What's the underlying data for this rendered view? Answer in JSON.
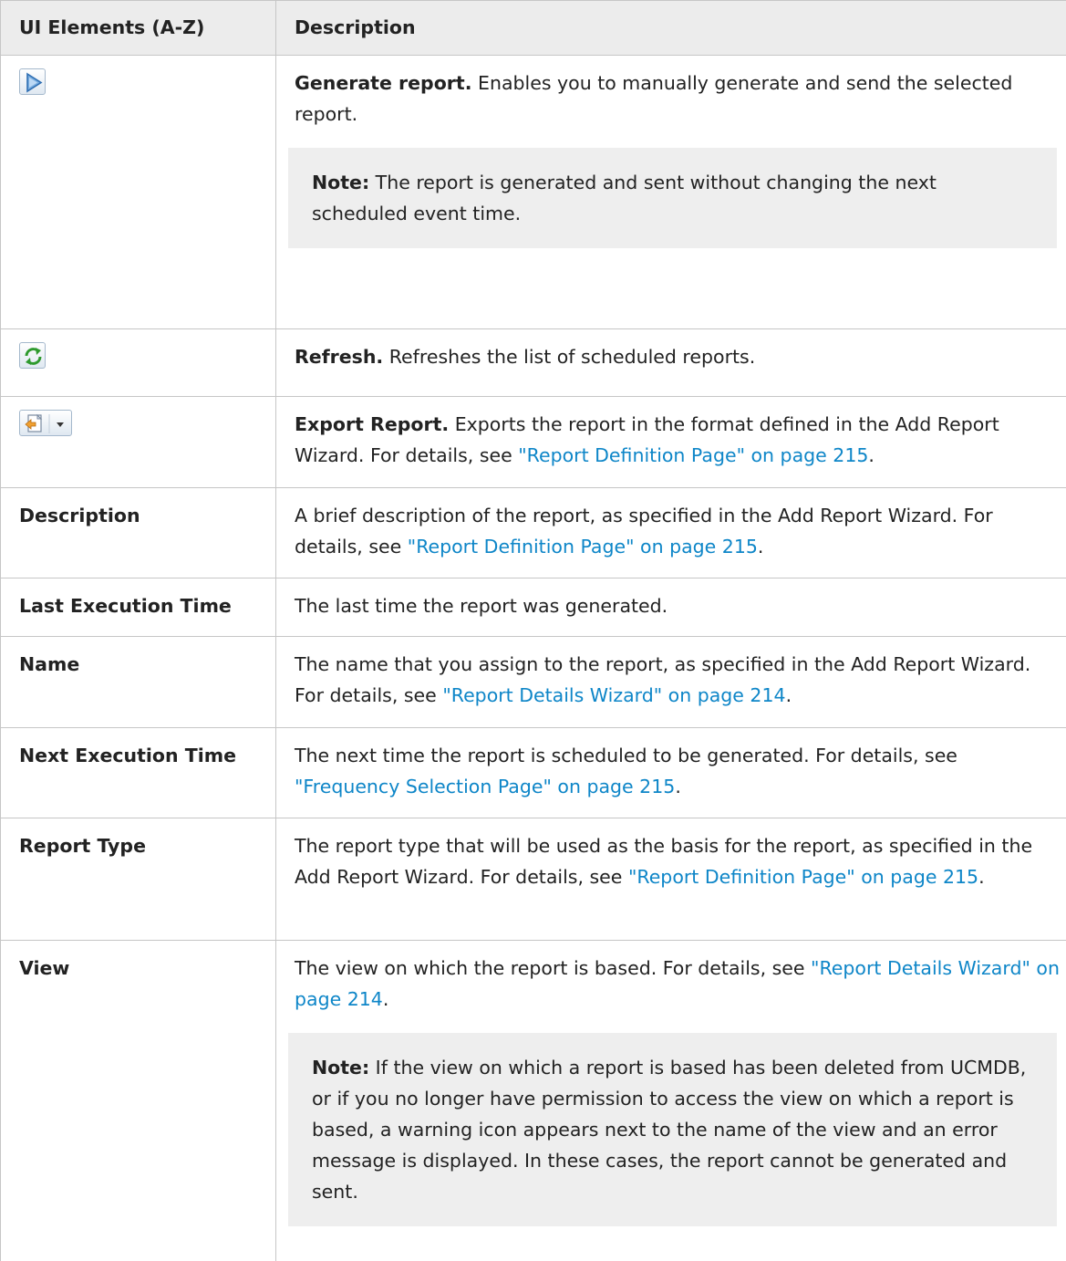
{
  "table": {
    "headers": [
      "UI Elements (A-Z)",
      "Description"
    ],
    "rows": [
      {
        "element_icon": "play-icon",
        "lead": "Generate report.",
        "text": " Enables you to manually generate and send the selected report.",
        "note_label": "Note:",
        "note_text": " The report is generated and sent without changing the next scheduled event time."
      },
      {
        "element_icon": "refresh-icon",
        "lead": "Refresh.",
        "text": " Refreshes the list of scheduled reports."
      },
      {
        "element_icon": "export-icon",
        "lead": "Export Report.",
        "text": " Exports the report in the format defined in the Add Report Wizard. For details, see ",
        "link": "\"Report Definition Page\" on page 215",
        "after": "."
      },
      {
        "element": "Description",
        "text": "A brief description of the report, as specified in the Add Report Wizard. For details, see ",
        "link": "\"Report Definition Page\" on page 215",
        "after": "."
      },
      {
        "element": "Last Execution Time",
        "text": "The last time the report was generated."
      },
      {
        "element": "Name",
        "text": "The name that you assign to the report, as specified in the Add Report Wizard. For details, see ",
        "link": "\"Report Details Wizard\" on page 214",
        "after": "."
      },
      {
        "element": "Next Execution Time",
        "text": "The next time the report is scheduled to be generated. For details, see ",
        "link": "\"Frequency Selection Page\" on page 215",
        "after": "."
      },
      {
        "element": "Report Type",
        "text": "The report type that will be used as the basis for the report, as specified in the Add Report Wizard. For details, see ",
        "link": "\"Report Definition Page\" on page 215",
        "after": "."
      },
      {
        "element": "View",
        "text": "The view on which the report is based. For details, see ",
        "link": "\"Report Details Wizard\" on page 214",
        "after": ".",
        "note_label": "Note:",
        "note_text": " If the view on which a report is based has been deleted from UCMDB, or if you no longer have permission to access the view on which a report is based, a warning icon appears next to the name of the view and an error message is displayed. In these cases, the report cannot be generated and sent."
      }
    ]
  },
  "colors": {
    "link": "#0e86c8",
    "header_bg": "#ececec",
    "note_bg": "#eeeeee"
  }
}
